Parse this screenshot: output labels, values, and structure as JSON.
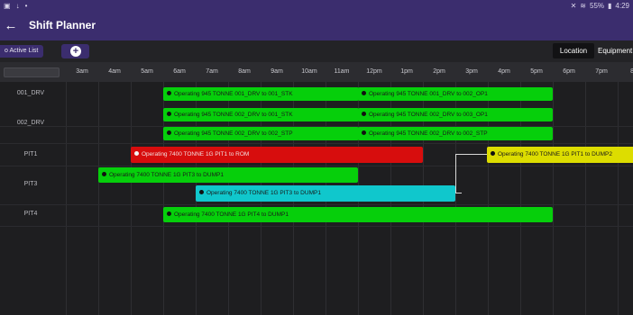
{
  "status": {
    "left_icons": [
      "screenshot-icon",
      "download-icon",
      "dot-icon"
    ],
    "battery": "55%",
    "time": "4:29"
  },
  "app": {
    "title": "Shift Planner"
  },
  "toolbar": {
    "active_list_label": "o Active List",
    "tab_location": "Location",
    "tab_equipment": "Equipment"
  },
  "timeline": {
    "hours": [
      "3am",
      "4am",
      "5am",
      "6am",
      "7am",
      "8am",
      "9am",
      "10am",
      "11am",
      "12pm",
      "1pm",
      "2pm",
      "3pm",
      "4pm",
      "5pm",
      "6pm",
      "7pm",
      "8p"
    ]
  },
  "rows": [
    {
      "label": "001_DRV"
    },
    {
      "label": "002_DRV"
    },
    {
      "label": "PIT1"
    },
    {
      "label": "PIT3"
    },
    {
      "label": "PIT4"
    }
  ],
  "tasks": [
    {
      "label": "Operating 945 TONNE 001_DRV to 001_STK",
      "color": "green"
    },
    {
      "label": "Operating 945 TONNE 001_DRV to 002_OP1",
      "color": "green"
    },
    {
      "label": "Operating 945 TONNE 002_DRV to 001_STK",
      "color": "green"
    },
    {
      "label": "Operating 945 TONNE 002_DRV to 003_OP1",
      "color": "green"
    },
    {
      "label": "Operating 945 TONNE 002_DRV to 002_STP",
      "color": "green"
    },
    {
      "label": "Operating 945 TONNE 002_DRV to 002_STP",
      "color": "green"
    },
    {
      "label": "Operating 7400 TONNE 1G PIT1 to ROM",
      "color": "red"
    },
    {
      "label": "Operating 7400 TONNE 1G PIT1 to DUMP2",
      "color": "yellow"
    },
    {
      "label": "Operating 7400 TONNE 1G PIT3 to DUMP1",
      "color": "green"
    },
    {
      "label": "Operating 7400 TONNE 1G PIT3 to DUMP1",
      "color": "cyan"
    },
    {
      "label": "Operating 7400 TONNE 1G PIT4 to DUMP1",
      "color": "green"
    }
  ]
}
